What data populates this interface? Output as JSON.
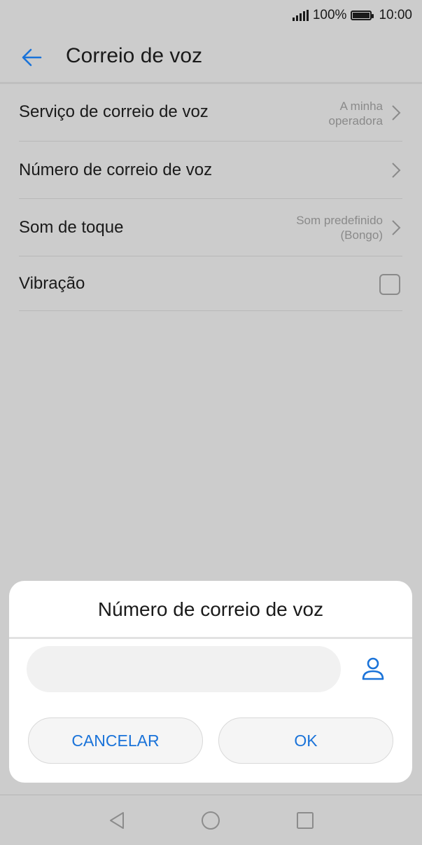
{
  "status_bar": {
    "battery": "100%",
    "time": "10:00"
  },
  "app_bar": {
    "title": "Correio de voz"
  },
  "settings": {
    "items": [
      {
        "label": "Serviço de correio de voz",
        "value_line1": "A minha",
        "value_line2": "operadora"
      },
      {
        "label": "Número de correio de voz"
      },
      {
        "label": "Som de toque",
        "value_line1": "Som predefinido",
        "value_line2": "(Bongo)"
      },
      {
        "label": "Vibração",
        "checked": false
      }
    ]
  },
  "dialog": {
    "title": "Número de correio de voz",
    "input_value": "",
    "cancel_label": "CANCELAR",
    "ok_label": "OK"
  },
  "colors": {
    "accent": "#1a73d9",
    "scrim": "#cccccc",
    "dialog_bg": "#ffffff"
  },
  "icons": [
    "signal-icon",
    "battery-icon",
    "back-arrow-icon",
    "chevron-right-icon",
    "contact-icon",
    "nav-back-icon",
    "nav-home-icon",
    "nav-recents-icon"
  ]
}
